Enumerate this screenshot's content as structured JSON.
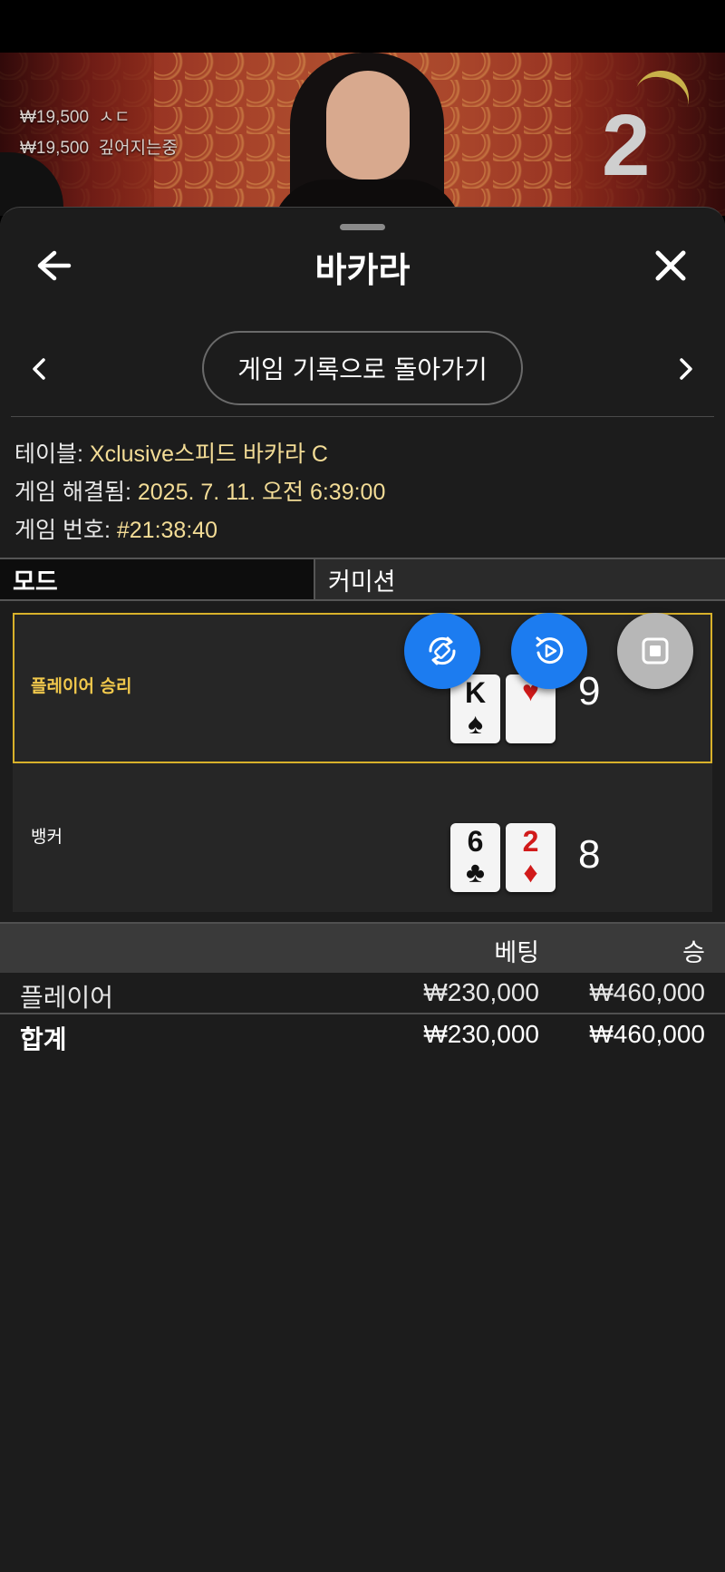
{
  "stream": {
    "ticker": [
      {
        "amount": "₩19,500",
        "name": "ㅅㄷ"
      },
      {
        "amount": "₩19,500",
        "name": "깊어지는중"
      }
    ],
    "round_number": "2"
  },
  "header": {
    "title": "바카라",
    "back_icon": "arrow-left-icon",
    "close_icon": "close-icon"
  },
  "nav": {
    "back_to_history_label": "게임 기록으로 돌아가기"
  },
  "info": {
    "table_label": "테이블:",
    "table_value": "Xclusive스피드 바카라 C",
    "resolved_label": "게임 해결됨:",
    "resolved_value": "2025. 7. 11. 오전 6:39:00",
    "game_no_label": "게임 번호:",
    "game_no_value": "#21:38:40"
  },
  "mode": {
    "label": "모드",
    "value": "커미션"
  },
  "result": {
    "player": {
      "label": "플레이어 승리",
      "cards": [
        {
          "rank": "K",
          "suit": "♠",
          "color": "black"
        },
        {
          "rank": "",
          "suit": "♥",
          "color": "red"
        }
      ],
      "score": "9"
    },
    "banker": {
      "label": "뱅커",
      "cards": [
        {
          "rank": "6",
          "suit": "♣",
          "color": "black"
        },
        {
          "rank": "2",
          "suit": "♦",
          "color": "red"
        }
      ],
      "score": "8"
    }
  },
  "bets": {
    "col_bet": "베팅",
    "col_win": "승",
    "rows": [
      {
        "name": "플레이어",
        "bet": "₩230,000",
        "win": "₩460,000"
      }
    ],
    "total": {
      "name": "합계",
      "bet": "₩230,000",
      "win": "₩460,000"
    }
  },
  "colors": {
    "accent_gold": "#d8b12a",
    "value_text": "#f3dc96",
    "fab_blue": "#1c7cf0",
    "sheet_bg": "#1c1c1c"
  }
}
